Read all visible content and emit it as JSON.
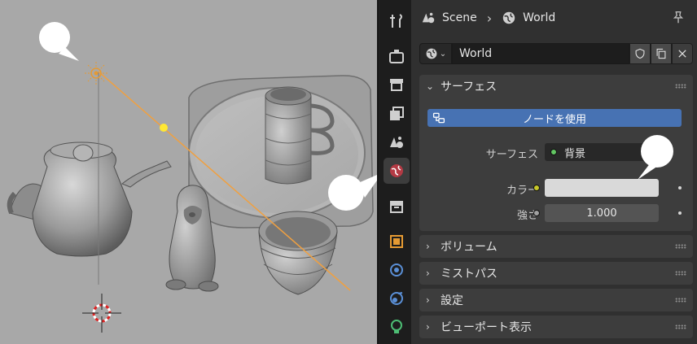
{
  "breadcrumb": {
    "scene": "Scene",
    "world": "World"
  },
  "world_block": {
    "name": "World"
  },
  "panels": {
    "surface": {
      "title": "サーフェス",
      "use_nodes_label": "ノードを使用",
      "surface_label": "サーフェス",
      "surface_value": "背景",
      "color_label": "カラー",
      "color_value": "#d9d9d9",
      "strength_label": "強さ",
      "strength_value": "1.000"
    },
    "volume": {
      "title": "ボリューム"
    },
    "mist": {
      "title": "ミストパス"
    },
    "settings": {
      "title": "設定"
    },
    "viewport_display": {
      "title": "ビューポート表示"
    }
  },
  "tabs": [
    "tool",
    "render",
    "output",
    "view-layer",
    "scene",
    "world",
    "collection",
    "object",
    "modifiers",
    "physics",
    "object-data-light"
  ],
  "active_tab": "world",
  "colors": {
    "accent_blue": "#4772b3",
    "socket_green": "#63c763",
    "socket_yellow": "#c7c729",
    "socket_gray": "#a1a1a1",
    "light_orange": "#e59a33",
    "light_line": "#f0a040",
    "selected_yellow": "#ffe833"
  }
}
